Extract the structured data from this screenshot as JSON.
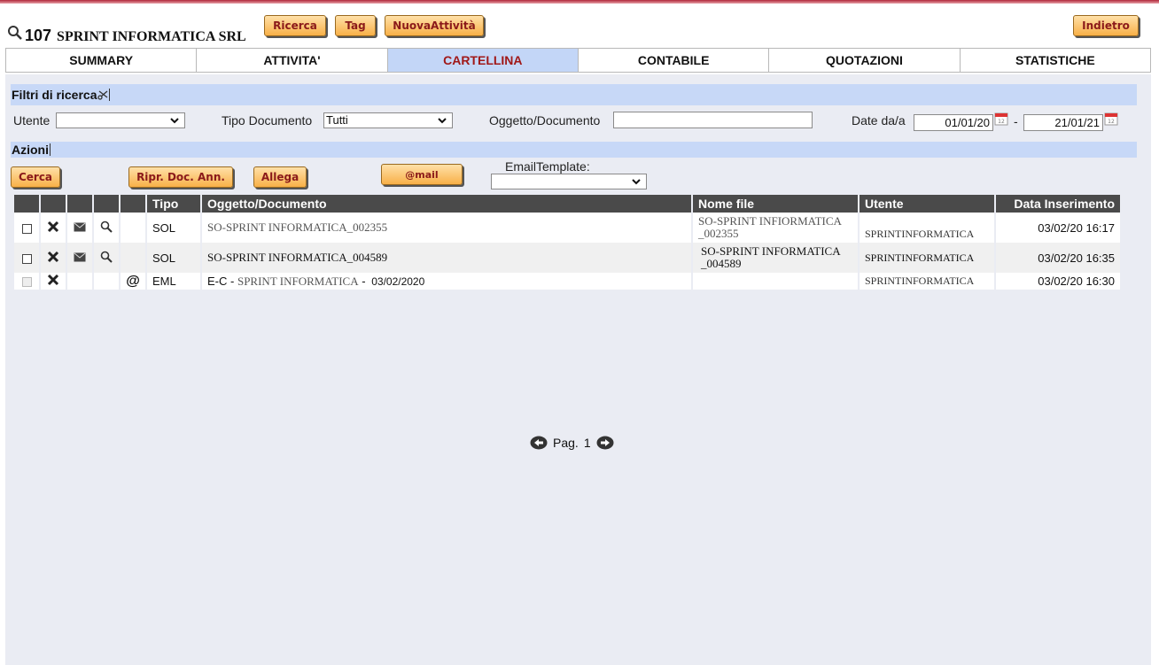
{
  "header": {
    "company_id": "107",
    "company_name": "SPRINT INFORMATICA SRL",
    "buttons": {
      "ricerca": "Ricerca",
      "tag": "Tag",
      "nuova_attivita": "NuovaAttività",
      "indietro": "Indietro"
    }
  },
  "tabs": [
    {
      "label": "SUMMARY",
      "active": false
    },
    {
      "label": "ATTIVITA'",
      "active": false
    },
    {
      "label": "CARTELLINA",
      "active": true
    },
    {
      "label": "CONTABILE",
      "active": false
    },
    {
      "label": "QUOTAZIONI",
      "active": false
    },
    {
      "label": "STATISTICHE",
      "active": false
    }
  ],
  "filters": {
    "title": "Filtri di ricerca",
    "utente_label": "Utente",
    "utente_value": "",
    "tipo_documento_label": "Tipo Documento",
    "tipo_documento_value": "Tutti",
    "oggetto_label": "Oggetto/Documento",
    "oggetto_value": "",
    "date_label": "Date da/a",
    "date_from": "01/01/20",
    "date_sep": "-",
    "date_to": "21/01/21"
  },
  "actions": {
    "title": "Azioni",
    "cerca": "Cerca",
    "ripr_doc_ann": "Ripr. Doc. Ann.",
    "allega": "Allega",
    "email": "@mail",
    "email_template_label": "EmailTemplate:",
    "email_template_value": ""
  },
  "table": {
    "headers": {
      "tipo": "Tipo",
      "oggetto": "Oggetto/Documento",
      "nome_file": "Nome file",
      "utente": "Utente",
      "data": "Data Inserimento"
    },
    "rows": [
      {
        "tipo": "SOL",
        "oggetto": "SO-SPRINT INFORMATICA_002355",
        "nome_file_1": "SO-SPRINT INFIORMATICA",
        "nome_file_2": "_002355",
        "utente": "SPRINTINFORMATICA",
        "data": "03/02/20 16:17"
      },
      {
        "tipo": "SOL",
        "oggetto": "SO-SPRINT INFORMATICA_004589",
        "nome_file_1": "SO-SPRINT INFORMATICA",
        "nome_file_2": "_004589",
        "utente": "SPRINTINFORMATICA",
        "data": "03/02/20 16:35"
      },
      {
        "tipo": "EML",
        "oggetto_prefix": "E-C -",
        "oggetto_mid": "SPRINT INFORMATICA",
        "oggetto_sep": "-",
        "oggetto_date": "03/02/2020",
        "nome_file_1": "",
        "utente": "SPRINTINFORMATICA",
        "data": "03/02/20 16:30"
      }
    ]
  },
  "pager": {
    "label": "Pag.",
    "page": "1"
  },
  "colors": {
    "accent_tab": "#c3d6f7",
    "panel_bg": "#eaecf3",
    "header_dark": "#4a4a4a",
    "button_text": "#8b1a1a"
  },
  "icons": [
    "search-icon",
    "delete-icon",
    "mail-icon",
    "magnify-icon",
    "at-icon",
    "calendar-icon",
    "chevron-down-icon",
    "prev-page-icon",
    "next-page-icon"
  ]
}
